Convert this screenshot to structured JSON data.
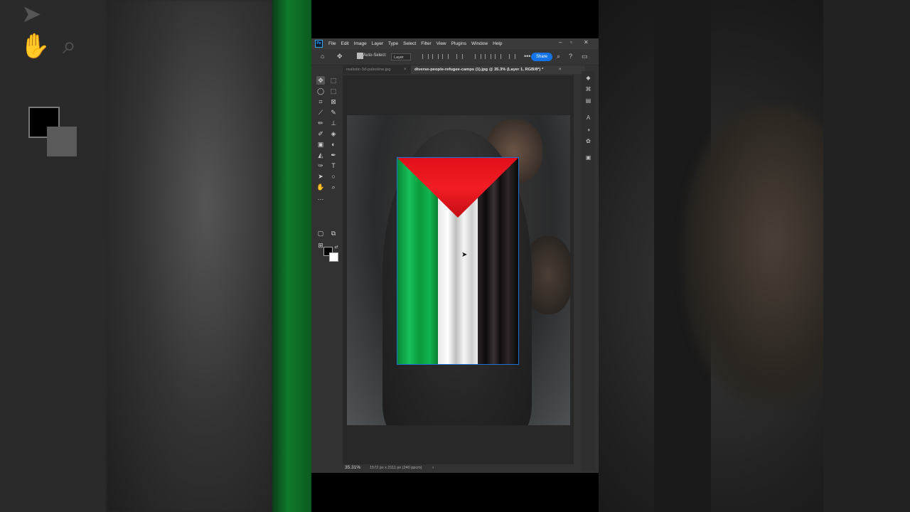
{
  "menu": {
    "app_badge": "Ps",
    "items": [
      "File",
      "Edit",
      "Image",
      "Layer",
      "Type",
      "Select",
      "Filter",
      "View",
      "Plugins",
      "Window",
      "Help"
    ]
  },
  "options": {
    "auto_select_label": "Auto-Select:",
    "auto_select_value": "Layer",
    "share_label": "Share"
  },
  "tabs": [
    {
      "label": "realistic-3d-palestine.jpg"
    },
    {
      "label": "diverse-people-refugee-camps (1).jpg @ 35.3% (Layer 1, RGB/8*) *"
    }
  ],
  "status": {
    "zoom": "35.31%",
    "doc_info": "1572 px x 2111 px (240 ppcm)",
    "arrow": "›"
  },
  "colors": {
    "accent": "#1473e6",
    "flag_green": "#12b452",
    "flag_red": "#e0101a",
    "flag_black": "#0f0b0c",
    "flag_white": "#ffffff"
  }
}
